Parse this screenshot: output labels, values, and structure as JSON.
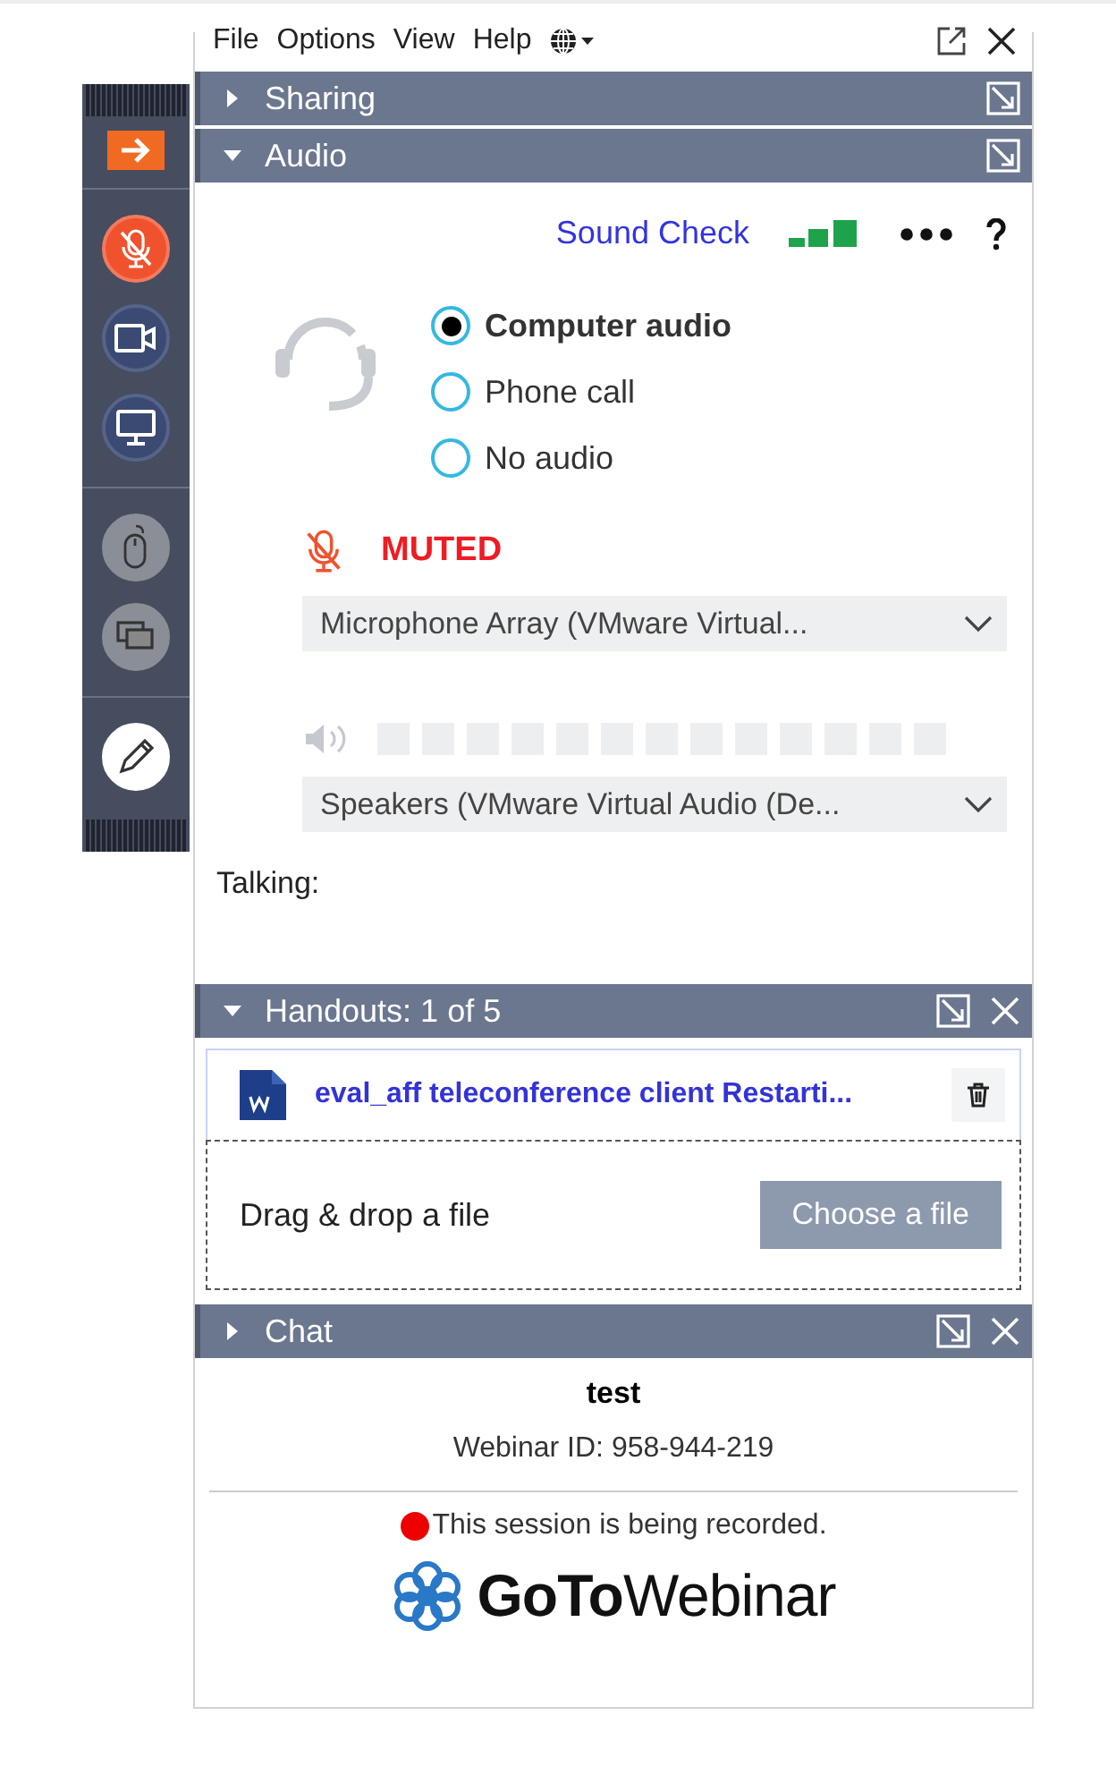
{
  "menu": {
    "items": [
      "File",
      "Options",
      "View",
      "Help"
    ]
  },
  "toolbar": [
    {
      "kind": "exit",
      "disabled": false
    },
    {
      "kind": "mic",
      "disabled": false,
      "muted": true
    },
    {
      "kind": "camera",
      "disabled": false
    },
    {
      "kind": "screen",
      "disabled": false
    },
    {
      "kind": "mouse",
      "disabled": true
    },
    {
      "kind": "screens",
      "disabled": true
    },
    {
      "kind": "pen",
      "disabled": false
    }
  ],
  "panels": [
    {
      "kind": "sharing",
      "title": "Sharing",
      "expanded": false,
      "closable": false
    },
    {
      "kind": "audio",
      "title": "Audio",
      "expanded": true,
      "closable": false,
      "sound_check": "Sound Check",
      "options": [
        {
          "label": "Computer audio",
          "selected": true
        },
        {
          "label": "Phone call",
          "selected": false
        },
        {
          "label": "No audio",
          "selected": false
        }
      ],
      "muted": true,
      "mute_label": "MUTED",
      "microphone": "Microphone Array (VMware Virtual...",
      "speakers": "Speakers (VMware Virtual Audio (De...",
      "talking": "Talking:"
    },
    {
      "kind": "handouts",
      "title": "Handouts: 1 of 5",
      "expanded": true,
      "closable": true,
      "files": [
        {
          "name": "eval_aff teleconference client Restarti..."
        }
      ],
      "drop_label": "Drag & drop a file",
      "choose_button": "Choose a file"
    },
    {
      "kind": "chat",
      "title": "Chat",
      "expanded": false,
      "closable": true
    }
  ],
  "footer": {
    "title": "test",
    "webinar_id": "Webinar ID: 958-944-219",
    "recording": "This session is being recorded.",
    "logo": "**GoTo**Webinar"
  }
}
